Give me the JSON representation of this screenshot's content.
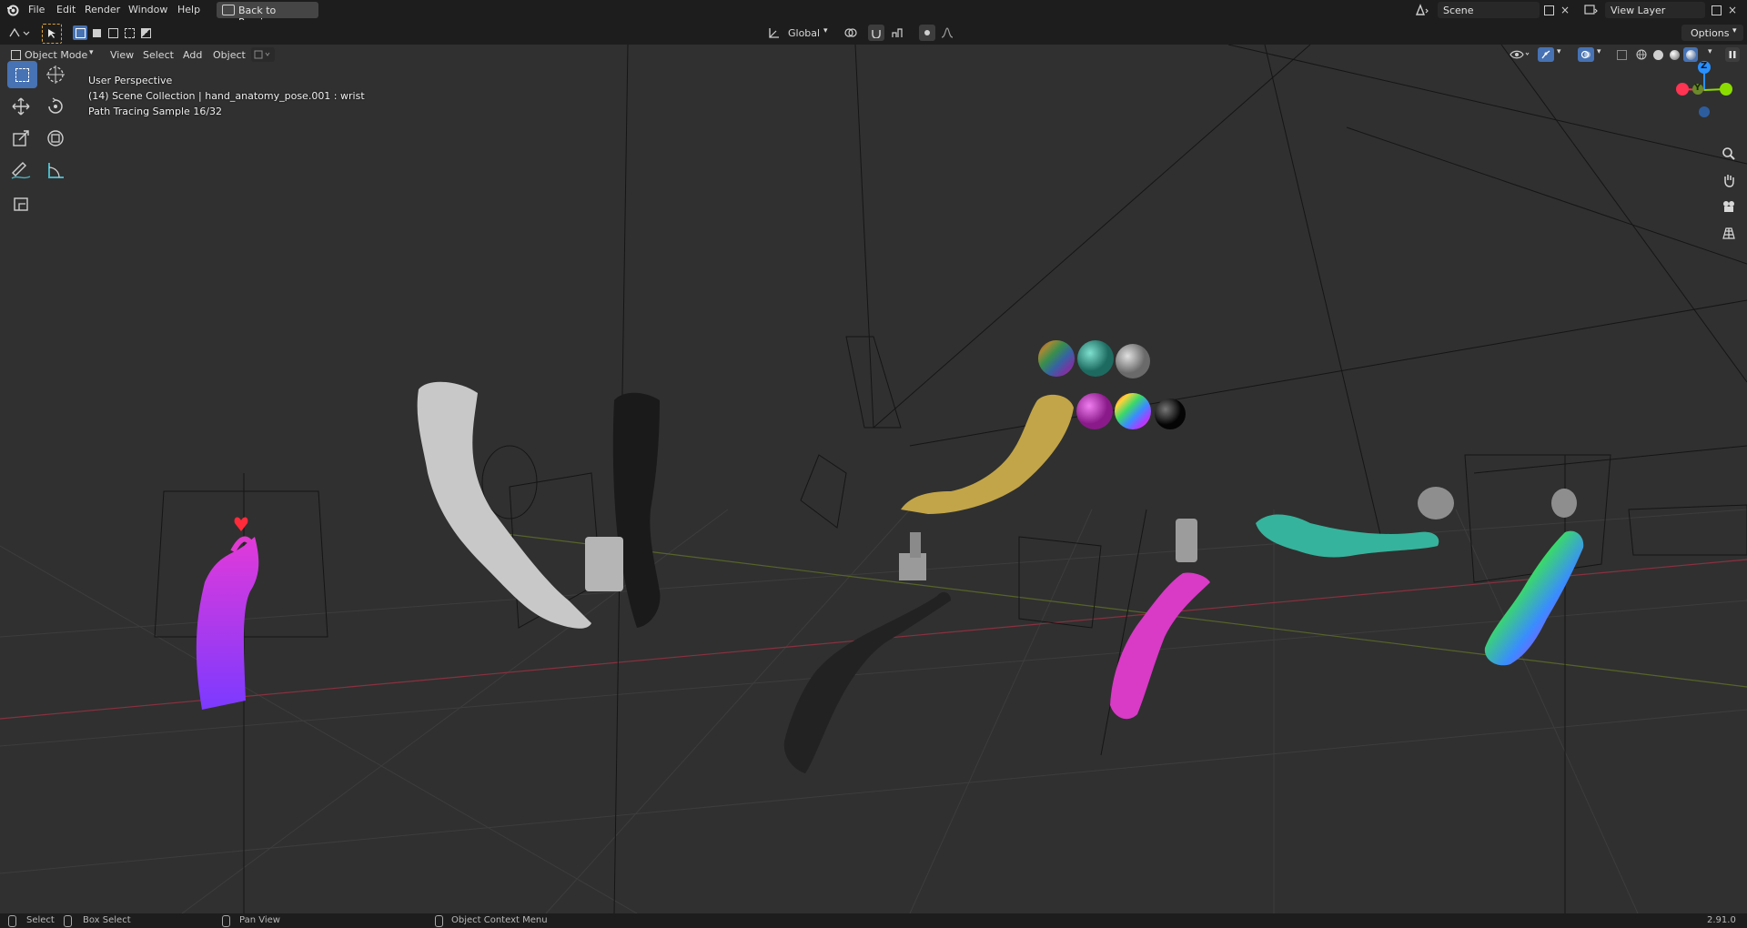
{
  "topbar": {
    "menus": [
      "File",
      "Edit",
      "Render",
      "Window",
      "Help"
    ],
    "back_button": "Back to Previous",
    "scene_label": "Scene",
    "view_layer_label": "View Layer"
  },
  "header": {
    "mode": "Object Mode",
    "menus": [
      "View",
      "Select",
      "Add",
      "Object"
    ],
    "orientation": "Global",
    "options": "Options"
  },
  "overlay": {
    "line1": "User Perspective",
    "line2": "(14) Scene Collection | hand_anatomy_pose.001 : wrist",
    "line3": "Path Tracing Sample 16/32"
  },
  "gizmo": {
    "z": "Z",
    "y": "Y"
  },
  "statusbar": {
    "select": "Select",
    "box_select": "Box Select",
    "pan_view": "Pan View",
    "context_menu": "Object Context Menu",
    "version": "2.91.0"
  },
  "colors": {
    "accent": "#4772b3",
    "x_axis": "#ff3352",
    "y_axis": "#8bdc00",
    "z_axis": "#2890ff"
  }
}
